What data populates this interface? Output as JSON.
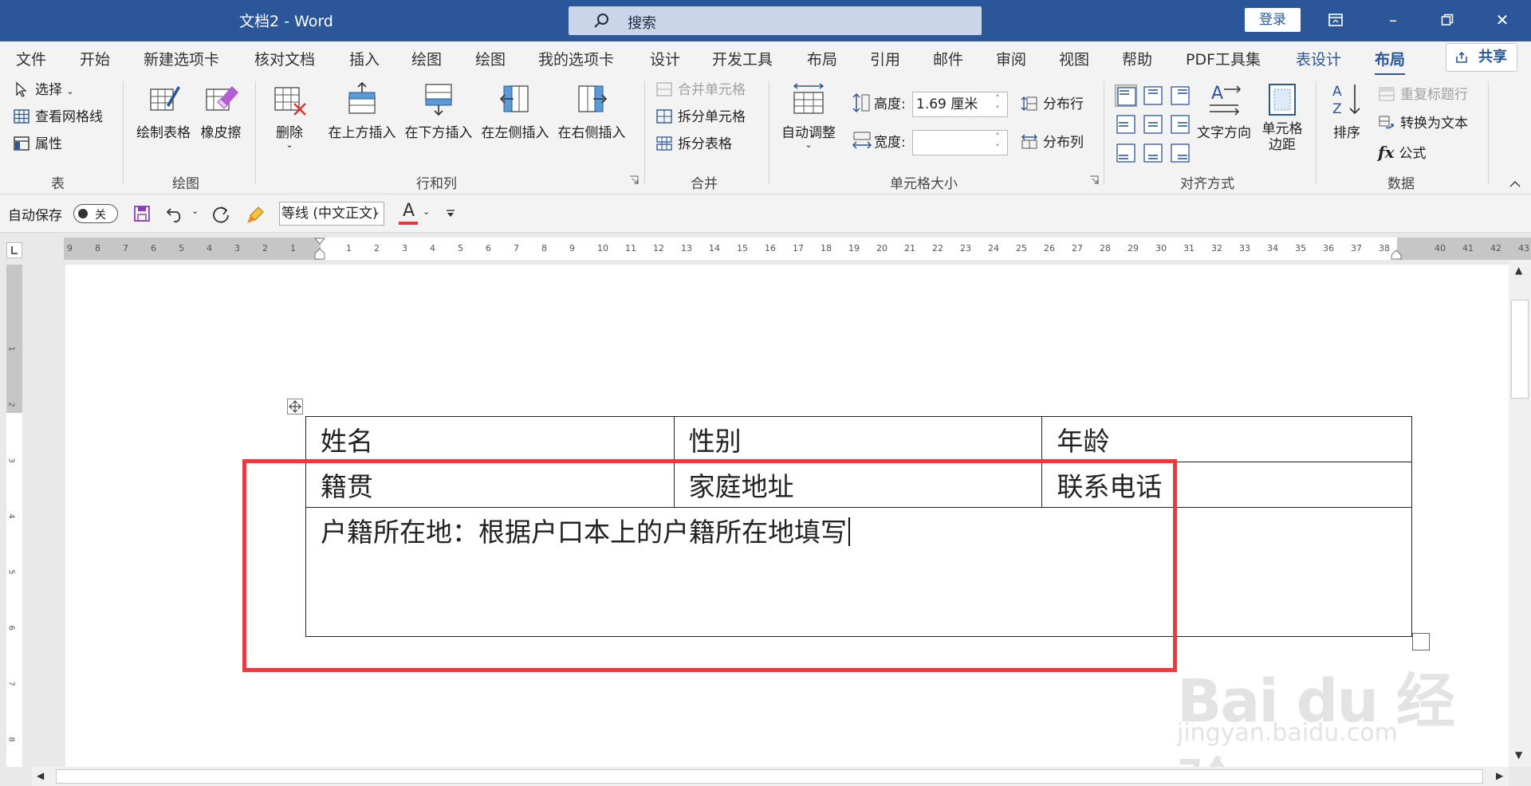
{
  "window": {
    "title": "文档2  -  Word",
    "search_label": "搜索",
    "login_label": "登录",
    "share_label": "共享"
  },
  "ribbon_tabs": [
    "文件",
    "开始",
    "新建选项卡",
    "核对文档",
    "插入",
    "绘图",
    "绘图",
    "我的选项卡",
    "设计",
    "开发工具",
    "布局",
    "引用",
    "邮件",
    "审阅",
    "视图",
    "帮助",
    "PDF工具集",
    "表设计",
    "布局"
  ],
  "active_tab": "布局",
  "groups": {
    "table": {
      "label": "表",
      "select": "选择",
      "gridlines": "查看网格线",
      "properties": "属性"
    },
    "draw": {
      "label": "绘图",
      "draw_table": "绘制表格",
      "eraser": "橡皮擦"
    },
    "rows_cols": {
      "label": "行和列",
      "delete": "删除",
      "insert_above": "在上方插入",
      "insert_below": "在下方插入",
      "insert_left": "在左侧插入",
      "insert_right": "在右侧插入"
    },
    "merge": {
      "label": "合并",
      "merge_cells": "合并单元格",
      "split_cells": "拆分单元格",
      "split_table": "拆分表格"
    },
    "cell_size": {
      "label": "单元格大小",
      "autofit": "自动调整",
      "height_label": "高度:",
      "height_value": "1.69 厘米",
      "width_label": "宽度:",
      "width_value": "",
      "distribute_rows": "分布行",
      "distribute_cols": "分布列"
    },
    "alignment": {
      "label": "对齐方式",
      "text_direction": "文字方向",
      "cell_margins_1": "单元格",
      "cell_margins_2": "边距"
    },
    "data": {
      "label": "数据",
      "sort": "排序",
      "repeat_header": "重复标题行",
      "convert_to_text": "转换为文本",
      "formula": "公式"
    }
  },
  "qat": {
    "autosave_label": "自动保存",
    "autosave_state": "关",
    "font_name": "等线 (中文正文)"
  },
  "ruler": {
    "h_ticks": [
      "9",
      "8",
      "7",
      "6",
      "5",
      "4",
      "3",
      "2",
      "1",
      "",
      "1",
      "2",
      "3",
      "4",
      "5",
      "6",
      "7",
      "8",
      "9",
      "10",
      "11",
      "12",
      "13",
      "14",
      "15",
      "16",
      "17",
      "18",
      "19",
      "20",
      "21",
      "22",
      "23",
      "24",
      "25",
      "26",
      "27",
      "28",
      "29",
      "30",
      "31",
      "32",
      "33",
      "34",
      "35",
      "36",
      "37",
      "38",
      "",
      "40",
      "41",
      "42",
      "43"
    ],
    "v_ticks": [
      "1",
      "2",
      "3",
      "4",
      "5",
      "6",
      "7",
      "8"
    ]
  },
  "document": {
    "rows": [
      [
        "姓名",
        "性别",
        "年龄"
      ],
      [
        "籍贯",
        "家庭地址",
        "联系电话"
      ]
    ],
    "merged_row": "户籍所在地：根据户口本上的户籍所在地填写"
  },
  "watermark": {
    "logo": "Bai du 经验",
    "url": "jingyan.baidu.com"
  },
  "colors": {
    "title_bar": "#2b579a",
    "highlight_box": "#ea3a3f",
    "ribbon_bg": "#f3f3f3"
  }
}
